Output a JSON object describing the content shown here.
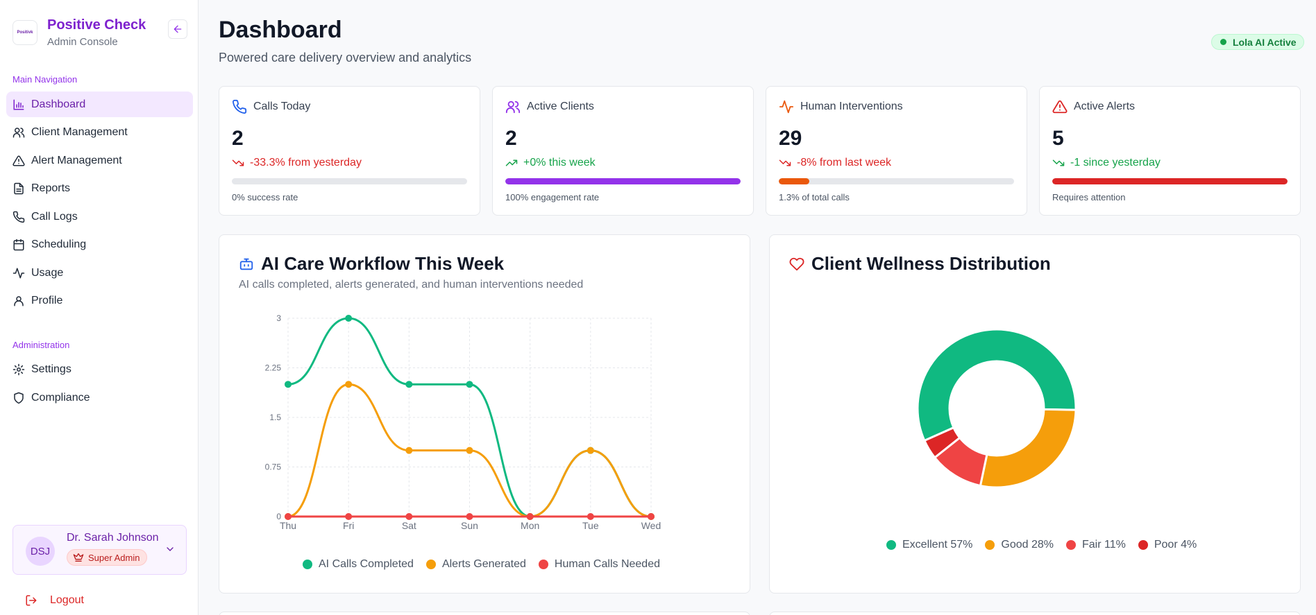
{
  "brand": {
    "logo_text": "Positivk",
    "title": "Positive Check",
    "subtitle": "Admin Console"
  },
  "sidebar": {
    "main_label": "Main Navigation",
    "items": [
      {
        "label": "Dashboard",
        "icon": "bar-chart-icon"
      },
      {
        "label": "Client Management",
        "icon": "users-icon"
      },
      {
        "label": "Alert Management",
        "icon": "alert-triangle-icon"
      },
      {
        "label": "Reports",
        "icon": "file-text-icon"
      },
      {
        "label": "Call Logs",
        "icon": "phone-icon"
      },
      {
        "label": "Scheduling",
        "icon": "calendar-icon"
      },
      {
        "label": "Usage",
        "icon": "activity-icon"
      },
      {
        "label": "Profile",
        "icon": "user-icon"
      }
    ],
    "admin_label": "Administration",
    "admin_items": [
      {
        "label": "Settings",
        "icon": "gear-icon"
      },
      {
        "label": "Compliance",
        "icon": "shield-icon"
      }
    ]
  },
  "user": {
    "initials": "DSJ",
    "name": "Dr. Sarah Johnson",
    "role": "Super Admin"
  },
  "logout_label": "Logout",
  "header": {
    "title": "Dashboard",
    "subtitle": "Powered care delivery overview and analytics",
    "ai_status": "Lola AI Active"
  },
  "stats": [
    {
      "title": "Calls Today",
      "value": "2",
      "change": "-33.3% from yesterday",
      "footer": "0% success rate",
      "progress": 0,
      "color": "#dc2626",
      "bar_color": "#9333ea",
      "icon_color": "#2563eb"
    },
    {
      "title": "Active Clients",
      "value": "2",
      "change": "+0% this week",
      "footer": "100% engagement rate",
      "progress": 100,
      "color": "#16a34a",
      "bar_color": "#9333ea",
      "icon_color": "#9333ea"
    },
    {
      "title": "Human Interventions",
      "value": "29",
      "change": "-8% from last week",
      "footer": "1.3% of total calls",
      "progress": 13,
      "color": "#dc2626",
      "bar_color": "#ea580c",
      "icon_color": "#ea580c"
    },
    {
      "title": "Active Alerts",
      "value": "5",
      "change": "-1 since yesterday",
      "footer": "Requires attention",
      "progress": 100,
      "color": "#16a34a",
      "bar_color": "#dc2626",
      "icon_color": "#dc2626"
    }
  ],
  "workflow_panel": {
    "title": "AI Care Workflow This Week",
    "subtitle": "AI calls completed, alerts generated, and human interventions needed"
  },
  "wellness_panel": {
    "title": "Client Wellness Distribution"
  },
  "chart_data": [
    {
      "type": "line",
      "title": "AI Care Workflow This Week",
      "categories": [
        "Thu",
        "Fri",
        "Sat",
        "Sun",
        "Mon",
        "Tue",
        "Wed"
      ],
      "yticks": [
        "0",
        "0.75",
        "1.5",
        "2.25",
        "3"
      ],
      "ylim": [
        0,
        3
      ],
      "grid": true,
      "legend": "bottom",
      "series": [
        {
          "name": "AI Calls Completed",
          "values": [
            2,
            3,
            2,
            2,
            0,
            1,
            0
          ],
          "color": "#10b981"
        },
        {
          "name": "Alerts Generated",
          "values": [
            0,
            2,
            1,
            1,
            0,
            1,
            0
          ],
          "color": "#f59e0b"
        },
        {
          "name": "Human Calls Needed",
          "values": [
            0,
            0,
            0,
            0,
            0,
            0,
            0
          ],
          "color": "#ef4444"
        }
      ]
    },
    {
      "type": "pie",
      "title": "Client Wellness Distribution",
      "legend": "bottom",
      "slices": [
        {
          "label": "Excellent 57%",
          "value": 57,
          "color": "#10b981"
        },
        {
          "label": "Good 28%",
          "value": 28,
          "color": "#f59e0b"
        },
        {
          "label": "Fair 11%",
          "value": 11,
          "color": "#ef4444"
        },
        {
          "label": "Poor 4%",
          "value": 4,
          "color": "#dc2626"
        }
      ]
    }
  ]
}
